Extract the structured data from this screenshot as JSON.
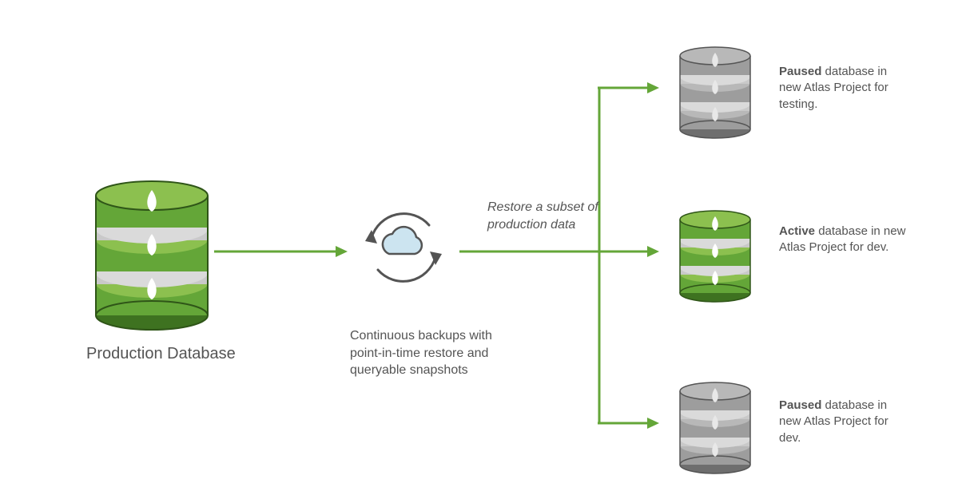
{
  "source": {
    "label": "Production Database"
  },
  "backup": {
    "description": "Continuous backups with point-in-time restore and queryable snapshots"
  },
  "restore": {
    "caption": "Restore a subset of production data"
  },
  "targets": [
    {
      "state": "Paused",
      "description": " database in new Atlas Project for testing."
    },
    {
      "state": "Active",
      "description": " database in new Atlas Project for dev."
    },
    {
      "state": "Paused",
      "description": " database in new Atlas Project for dev."
    }
  ],
  "colors": {
    "green": "#64A638",
    "lightgreen": "#8CC04F",
    "gray": "#9D9D9D",
    "graylight": "#B8B8B8",
    "outline": "#545454",
    "cloudfill": "#CCE4F0",
    "text": "#545454"
  }
}
